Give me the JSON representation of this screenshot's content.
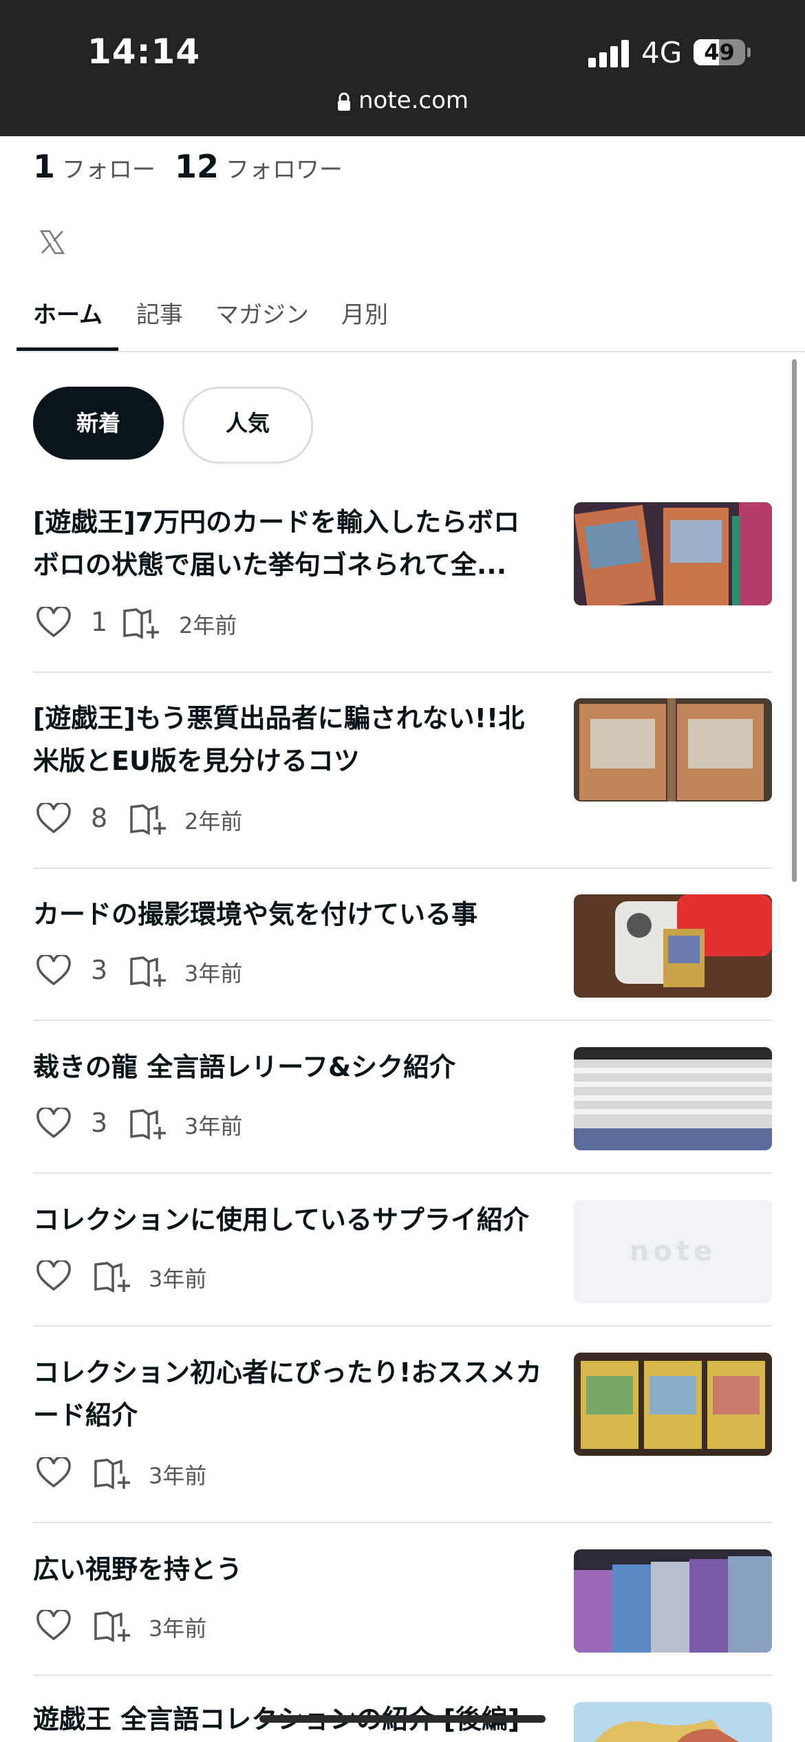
{
  "status": {
    "time": "14:14",
    "network": "4G",
    "battery": "49",
    "battery_level_pct": 49,
    "url": "note.com"
  },
  "profile": {
    "following_count": "1",
    "following_label": "フォロー",
    "followers_count": "12",
    "followers_label": "フォロワー"
  },
  "tabs": [
    {
      "label": "ホーム",
      "active": true
    },
    {
      "label": "記事",
      "active": false
    },
    {
      "label": "マガジン",
      "active": false
    },
    {
      "label": "月別",
      "active": false
    }
  ],
  "filters": {
    "new": "新着",
    "popular": "人気"
  },
  "articles": [
    {
      "title": "[遊戯王]7万円のカードを輸入したらボロボロの状態で届いた挙句ゴネられて全...",
      "likes": "1",
      "ago": "2年前"
    },
    {
      "title": "[遊戯王]もう悪質出品者に騙されない!!北米版とEU版を見分けるコツ",
      "likes": "8",
      "ago": "2年前"
    },
    {
      "title": "カードの撮影環境や気を付けている事",
      "likes": "3",
      "ago": "3年前"
    },
    {
      "title": "裁きの龍 全言語レリーフ&シク紹介",
      "likes": "3",
      "ago": "3年前"
    },
    {
      "title": "コレクションに使用しているサプライ紹介",
      "likes": "",
      "ago": "3年前",
      "thumb_text": "note"
    },
    {
      "title": "コレクション初心者にぴったり!おススメカード紹介",
      "likes": "",
      "ago": "3年前"
    },
    {
      "title": "広い視野を持とう",
      "likes": "",
      "ago": "3年前"
    },
    {
      "title": "遊戯王 全言語コレクションの紹介 [後編]",
      "likes": "",
      "ago": ""
    }
  ]
}
